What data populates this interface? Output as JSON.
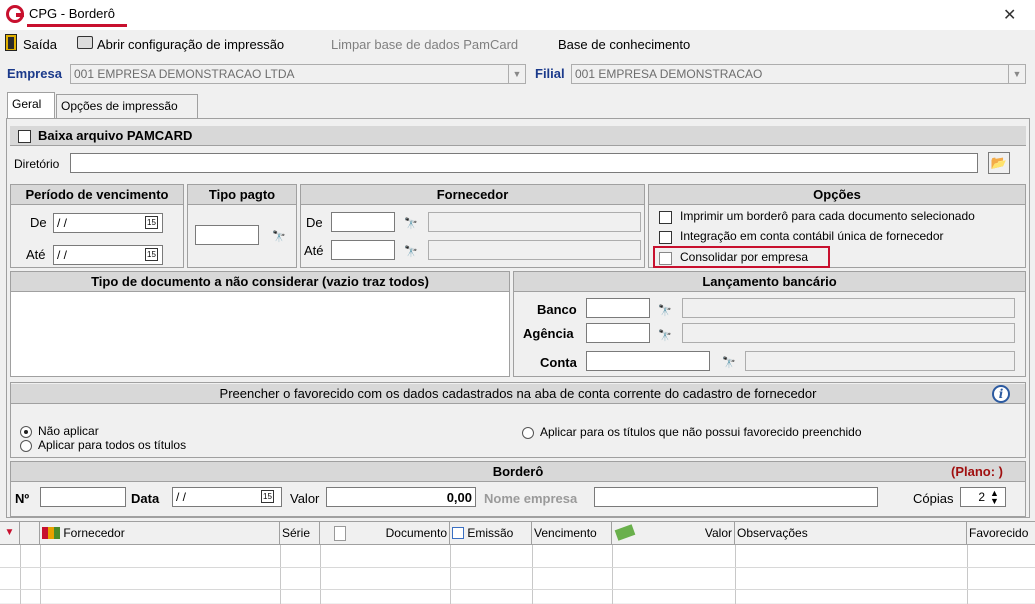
{
  "window": {
    "title": "CPG - Borderô",
    "close_icon": "close-icon"
  },
  "toolbar": {
    "exit_label": "Saída",
    "print_config_label": "Abrir configuração de impressão",
    "clear_pamcard_label": "Limpar base de dados PamCard",
    "knowledge_base_label": "Base de conhecimento"
  },
  "company": {
    "empresa_label": "Empresa",
    "empresa_value": "001 EMPRESA DEMONSTRACAO LTDA",
    "filial_label": "Filial",
    "filial_value": "001 EMPRESA DEMONSTRACAO"
  },
  "tabs": [
    {
      "label": "Geral"
    },
    {
      "label": "Opções de impressão"
    }
  ],
  "pamcard": {
    "checkbox_label": "Baixa arquivo PAMCARD",
    "dir_label": "Diretório",
    "dir_value": ""
  },
  "periodo": {
    "title": "Período de vencimento",
    "de_label": "De",
    "ate_label": "Até",
    "de_value": " / /",
    "ate_value": " / /"
  },
  "tipo_pagto": {
    "title": "Tipo pagto"
  },
  "fornecedor": {
    "title": "Fornecedor",
    "de_label": "De",
    "ate_label": "Até"
  },
  "opcoes": {
    "title": "Opções",
    "items": [
      {
        "label": "Imprimir um borderô para cada documento selecionado"
      },
      {
        "label": "Integração em conta contábil única de fornecedor"
      },
      {
        "label": "Consolidar por empresa"
      }
    ]
  },
  "tipo_doc": {
    "title": "Tipo de documento a não considerar (vazio traz todos)"
  },
  "lancamento": {
    "title": "Lançamento bancário",
    "banco_label": "Banco",
    "agencia_label": "Agência",
    "conta_label": "Conta"
  },
  "favorecido": {
    "text": "Preencher o favorecido com os dados cadastrados na aba de conta corrente do cadastro de fornecedor",
    "options": [
      {
        "label": "Não aplicar"
      },
      {
        "label": "Aplicar para todos os títulos"
      },
      {
        "label": "Aplicar para os títulos que não possui favorecido preenchido"
      }
    ]
  },
  "bordero": {
    "title": "Borderô",
    "plano_label": "(Plano: )",
    "numero_label": "Nº",
    "data_label": "Data",
    "data_value": " / /",
    "valor_label": "Valor",
    "valor_value": "0,00",
    "nome_empresa_label": "Nome empresa",
    "copias_label": "Cópias",
    "copias_value": "2"
  },
  "grid": {
    "columns": [
      "Fornecedor",
      "Série",
      "Documento",
      "Emissão",
      "Vencimento",
      "Valor",
      "Observações",
      "Favorecido"
    ]
  },
  "colors": {
    "accent_red": "#c8102e",
    "label_blue": "#1b3a8b"
  }
}
